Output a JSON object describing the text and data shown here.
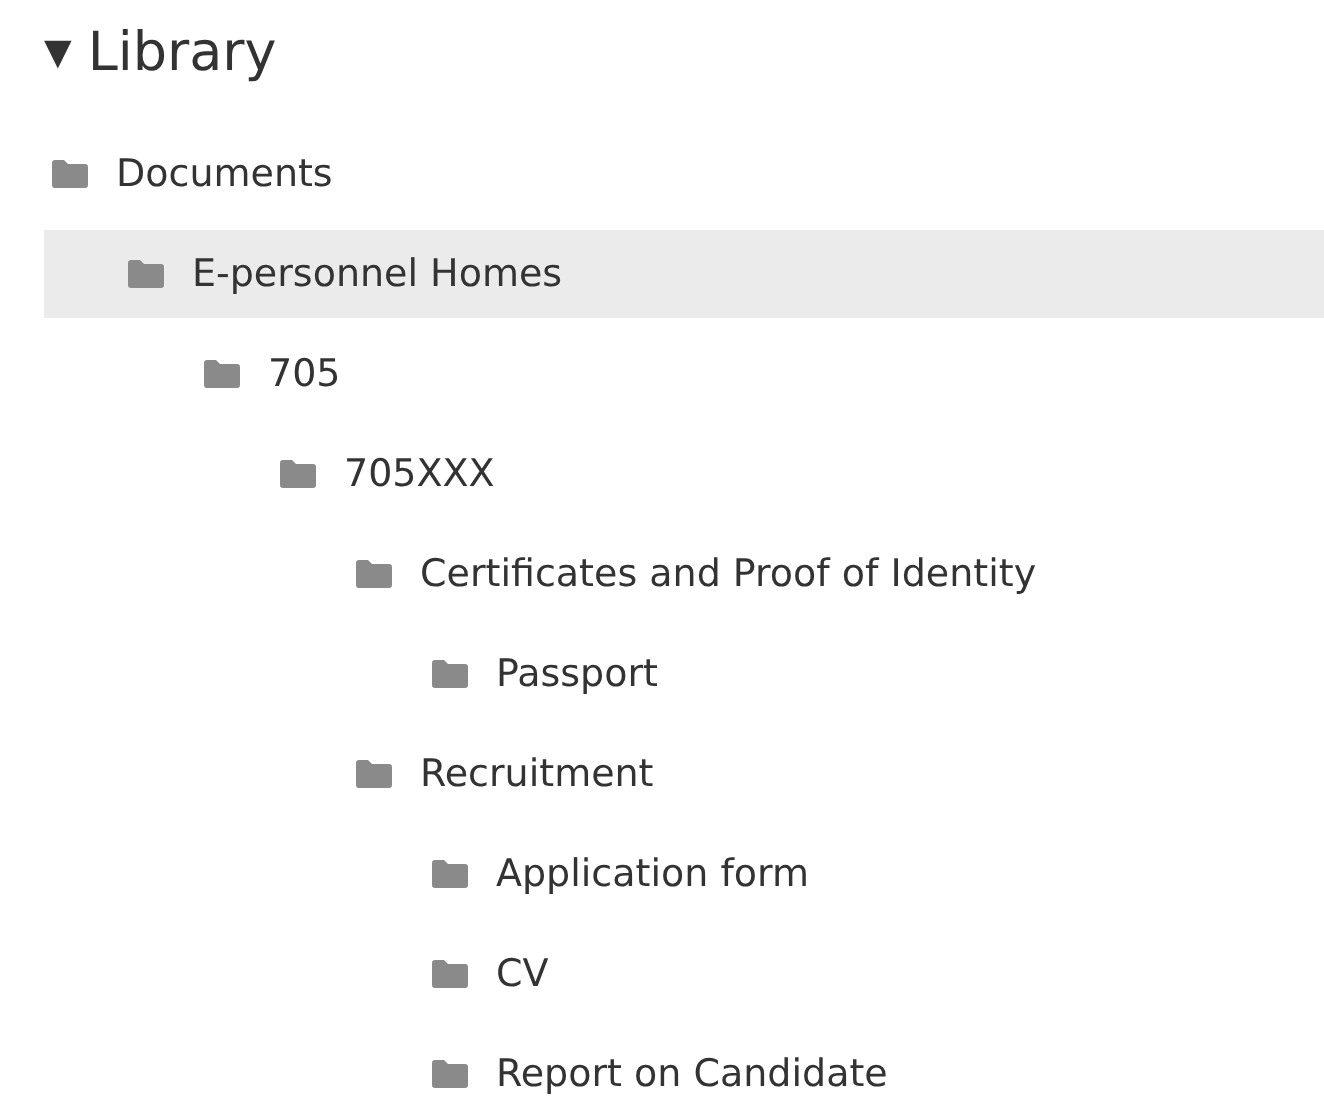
{
  "library": {
    "toggle": "▼",
    "title": "Library",
    "items": [
      {
        "label": "Documents",
        "selected": false,
        "children": [
          {
            "label": "E-personnel Homes",
            "selected": true,
            "children": [
              {
                "label": "705",
                "selected": false,
                "children": [
                  {
                    "label": "705XXX",
                    "selected": false,
                    "children": [
                      {
                        "label": "Certificates and Proof of Identity",
                        "selected": false,
                        "children": [
                          {
                            "label": "Passport",
                            "selected": false
                          }
                        ]
                      },
                      {
                        "label": "Recruitment",
                        "selected": false,
                        "children": [
                          {
                            "label": "Application form",
                            "selected": false
                          },
                          {
                            "label": "CV",
                            "selected": false
                          },
                          {
                            "label": "Report on Candidate",
                            "selected": false
                          }
                        ]
                      }
                    ]
                  }
                ]
              }
            ]
          }
        ]
      }
    ]
  }
}
